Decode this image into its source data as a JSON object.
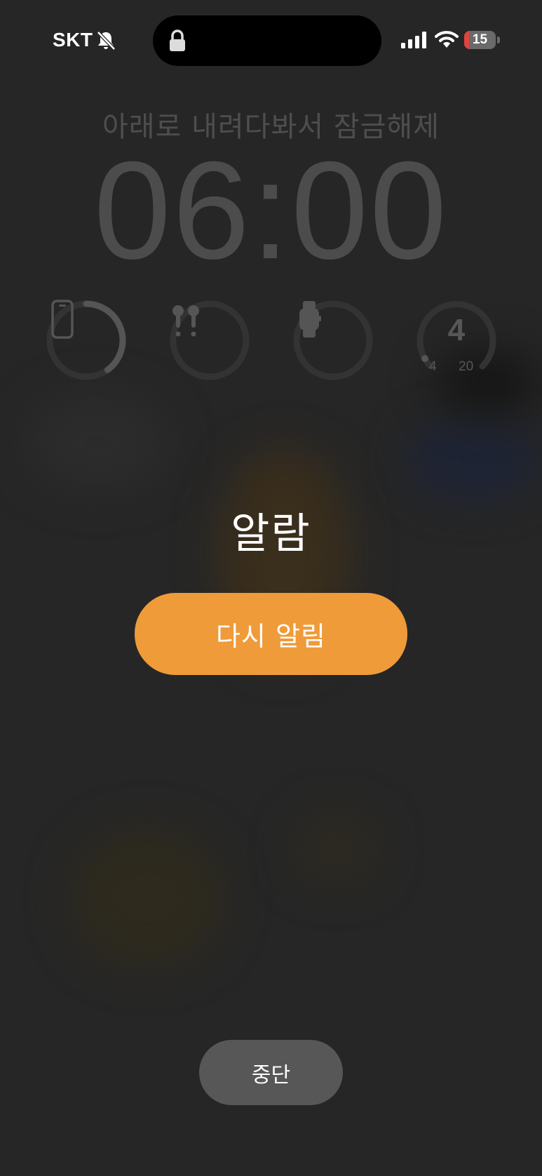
{
  "status_bar": {
    "carrier": "SKT",
    "silent_icon": "bell-slash-icon",
    "lock_icon": "lock-icon",
    "signal_icon": "cellular-signal-icon",
    "wifi_icon": "wifi-icon",
    "battery_level": "15",
    "battery_fraction": 0.15,
    "battery_color": "#e0443e"
  },
  "lock_screen": {
    "unlock_hint": "아래로 내려다봐서 잠금해제",
    "time": "06:00"
  },
  "widgets": [
    {
      "type": "battery",
      "icon": "iphone-icon",
      "level": 0.4
    },
    {
      "type": "battery",
      "icon": "airpods-icon",
      "level": 0
    },
    {
      "type": "battery",
      "icon": "apple-watch-icon",
      "level": 0
    },
    {
      "type": "temperature",
      "value": "4",
      "min": "4",
      "max": "20",
      "level": 0.0
    }
  ],
  "alarm": {
    "title": "알람",
    "snooze_label": "다시 알림",
    "stop_label": "중단",
    "accent_color": "#ef9b3a"
  }
}
